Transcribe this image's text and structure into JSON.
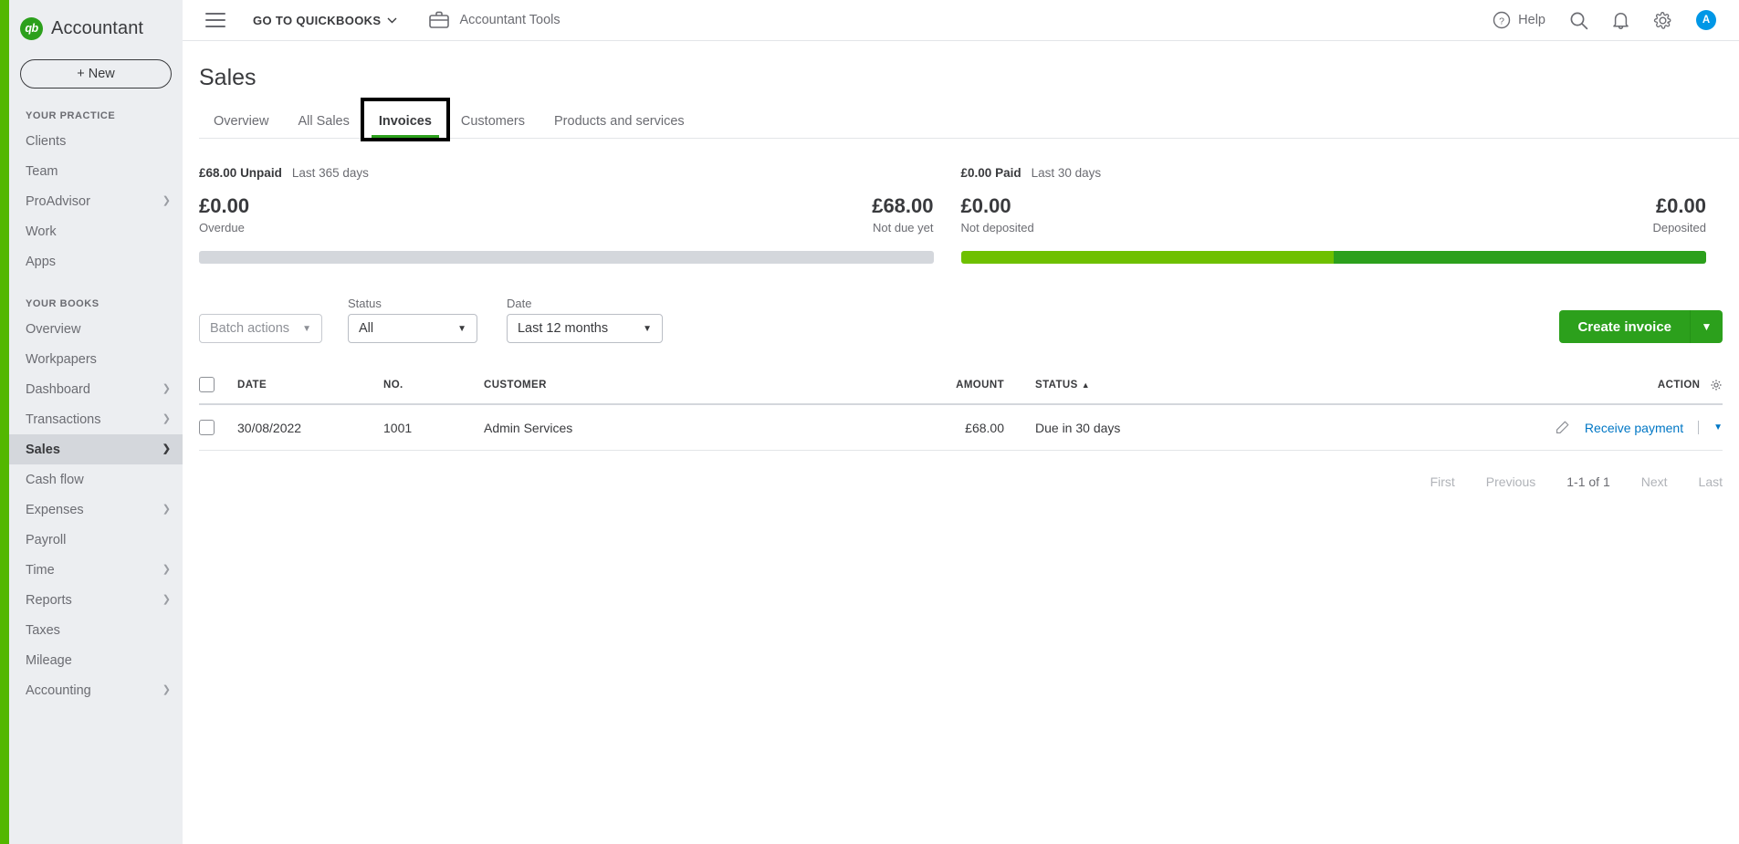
{
  "sidebar": {
    "brand": {
      "logo_text": "qb",
      "name": "Accountant"
    },
    "new_button": "+  New",
    "groups": [
      {
        "label": "YOUR PRACTICE",
        "items": [
          {
            "label": "Clients",
            "chevron": false,
            "active": false
          },
          {
            "label": "Team",
            "chevron": false,
            "active": false
          },
          {
            "label": "ProAdvisor",
            "chevron": true,
            "active": false
          },
          {
            "label": "Work",
            "chevron": false,
            "active": false
          },
          {
            "label": "Apps",
            "chevron": false,
            "active": false
          }
        ]
      },
      {
        "label": "YOUR BOOKS",
        "items": [
          {
            "label": "Overview",
            "chevron": false,
            "active": false
          },
          {
            "label": "Workpapers",
            "chevron": false,
            "active": false
          },
          {
            "label": "Dashboard",
            "chevron": true,
            "active": false
          },
          {
            "label": "Transactions",
            "chevron": true,
            "active": false
          },
          {
            "label": "Sales",
            "chevron": true,
            "active": true
          },
          {
            "label": "Cash flow",
            "chevron": false,
            "active": false
          },
          {
            "label": "Expenses",
            "chevron": true,
            "active": false
          },
          {
            "label": "Payroll",
            "chevron": false,
            "active": false
          },
          {
            "label": "Time",
            "chevron": true,
            "active": false
          },
          {
            "label": "Reports",
            "chevron": true,
            "active": false
          },
          {
            "label": "Taxes",
            "chevron": false,
            "active": false
          },
          {
            "label": "Mileage",
            "chevron": false,
            "active": false
          },
          {
            "label": "Accounting",
            "chevron": true,
            "active": false
          }
        ]
      }
    ],
    "accent_green": "#53b700",
    "background": "#eceef1"
  },
  "topbar": {
    "goto_quickbooks": "GO TO QUICKBOOKS",
    "accountant_tools": "Accountant Tools",
    "help": "Help",
    "avatar_initial": "A",
    "avatar_color": "#0097e6"
  },
  "page": {
    "title": "Sales",
    "tabs": [
      {
        "label": "Overview",
        "active": false
      },
      {
        "label": "All Sales",
        "active": false
      },
      {
        "label": "Invoices",
        "active": true
      },
      {
        "label": "Customers",
        "active": false
      },
      {
        "label": "Products and services",
        "active": false
      }
    ]
  },
  "summary": {
    "unpaid": {
      "headline_amount": "£68.00",
      "headline_label": "Unpaid",
      "period": "Last 365 days",
      "left": {
        "amount": "£0.00",
        "label": "Overdue"
      },
      "right": {
        "amount": "£68.00",
        "label": "Not due yet"
      },
      "segments": [
        {
          "name": "overdue",
          "percent": 0,
          "color": "#d4d7dc"
        },
        {
          "name": "not-due-yet",
          "percent": 100,
          "color": "#d4d7dc"
        }
      ]
    },
    "paid": {
      "headline_amount": "£0.00",
      "headline_label": "Paid",
      "period": "Last 30 days",
      "left": {
        "amount": "£0.00",
        "label": "Not deposited"
      },
      "right": {
        "amount": "£0.00",
        "label": "Deposited"
      },
      "segments": [
        {
          "name": "not-deposited",
          "percent": 50,
          "color": "#6ec000"
        },
        {
          "name": "deposited",
          "percent": 50,
          "color": "#2ca01c"
        }
      ]
    }
  },
  "filters": {
    "batch_actions": "Batch actions",
    "status_label": "Status",
    "status_value": "All",
    "date_label": "Date",
    "date_value": "Last 12 months",
    "create_invoice": "Create invoice"
  },
  "table": {
    "columns": {
      "date": "DATE",
      "no": "NO.",
      "customer": "CUSTOMER",
      "amount": "AMOUNT",
      "status": "STATUS",
      "status_sort": "▲",
      "action": "ACTION"
    },
    "rows": [
      {
        "date": "30/08/2022",
        "no": "1001",
        "customer": "Admin Services",
        "amount": "£68.00",
        "status": "Due in 30 days",
        "action": "Receive payment"
      }
    ]
  },
  "pagination": {
    "first": "First",
    "previous": "Previous",
    "count": "1-1 of 1",
    "next": "Next",
    "last": "Last"
  }
}
